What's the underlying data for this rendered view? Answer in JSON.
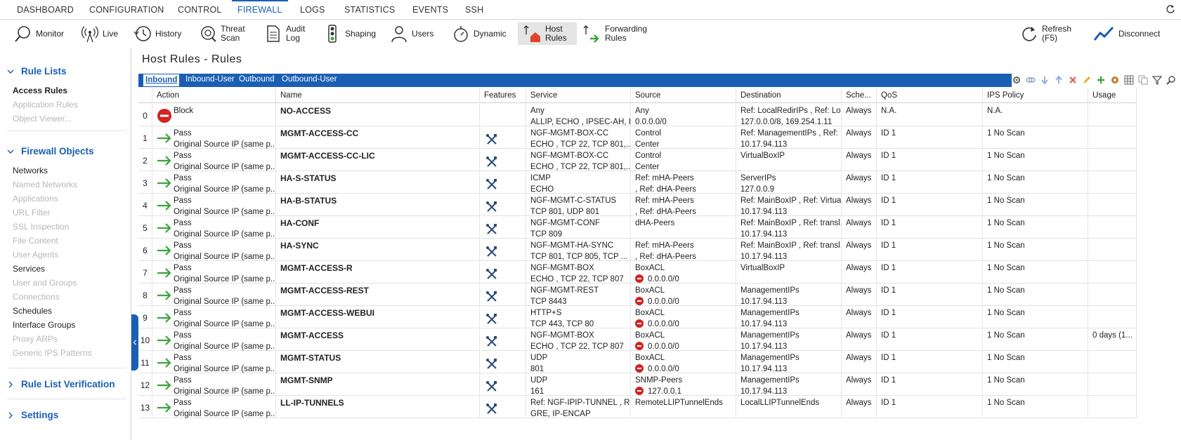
{
  "top_menu": [
    "DASHBOARD",
    "CONFIGURATION",
    "CONTROL",
    "FIREWALL",
    "LOGS",
    "STATISTICS",
    "EVENTS",
    "SSH"
  ],
  "active_menu": "FIREWALL",
  "toolbar": {
    "monitor": "Monitor",
    "live": "Live",
    "history": "History",
    "threat_scan_1": "Threat",
    "threat_scan_2": "Scan",
    "audit_log_1": "Audit",
    "audit_log_2": "Log",
    "shaping": "Shaping",
    "users": "Users",
    "dynamic": "Dynamic",
    "host_rules_1": "Host",
    "host_rules_2": "Rules",
    "forwarding_rules_1": "Forwarding",
    "forwarding_rules_2": "Rules",
    "refresh_1": "Refresh",
    "refresh_2": "(F5)",
    "disconnect": "Disconnect"
  },
  "sidebar": {
    "rule_lists": "Rule Lists",
    "access_rules": "Access Rules",
    "application_rules": "Application Rules",
    "object_viewer": "Object Viewer...",
    "firewall_objects": "Firewall Objects",
    "objects": [
      "Networks",
      "Named Networks",
      "Applications",
      "URL Filter",
      "SSL Inspection",
      "File Content",
      "User Agents",
      "Services",
      "User and Groups",
      "Connections",
      "Schedules",
      "Interface Groups",
      "Proxy ARPs",
      "Generic IPS Patterns"
    ],
    "rule_list_verification": "Rule List Verification",
    "settings": "Settings"
  },
  "page_title": "Host Rules - Rules",
  "tabs": [
    "Inbound",
    "Inbound-User",
    "Outbound",
    "Outbound-User"
  ],
  "columns": [
    "Action",
    "Name",
    "Features",
    "Service",
    "Source",
    "Destination",
    "Sche...",
    "QoS",
    "IPS Policy",
    "Usage"
  ],
  "rows": [
    {
      "num": "0",
      "action": "Block",
      "action2": "",
      "name": "NO-ACCESS",
      "service1": "Any",
      "service2": "ALLIP, ECHO , IPSEC-AH, I...",
      "source1": "Any",
      "source2": "0.0.0.0/0",
      "dest1": "Ref: LocalRedirIPs , Ref: Lo...",
      "dest2": "127.0.0.0/8, 169.254.1.11",
      "sched": "Always",
      "qos": "N.A.",
      "ips": "N.A.",
      "usage": ""
    },
    {
      "num": "1",
      "action": "Pass",
      "action2": "Original Source IP (same p...",
      "name": "MGMT-ACCESS-CC",
      "service1": "NGF-MGMT-BOX-CC",
      "service2": "ECHO , TCP  22, TCP  801,...",
      "source1": "Control",
      "source2": "Center",
      "dest1": "Ref: ManagementIPs , Ref: ...",
      "dest2": "10.17.94.113",
      "sched": "Always",
      "qos": "ID 1",
      "ips": "1 No Scan",
      "usage": ""
    },
    {
      "num": "2",
      "action": "Pass",
      "action2": "Original Source IP (same p...",
      "name": "MGMT-ACCESS-CC-LIC",
      "service1": "NGF-MGMT-BOX-CC",
      "service2": "ECHO , TCP  22, TCP  801,...",
      "source1": "Control",
      "source2": "Center",
      "dest1": "VirtualBoxIP",
      "dest2": "",
      "sched": "Always",
      "qos": "ID 1",
      "ips": "1 No Scan",
      "usage": ""
    },
    {
      "num": "3",
      "action": "Pass",
      "action2": "Original Source IP (same p...",
      "name": "HA-S-STATUS",
      "service1": "ICMP",
      "service2": "ECHO",
      "source1": "Ref: mHA-Peers",
      "source2": ", Ref: dHA-Peers",
      "dest1": "ServerIPs",
      "dest2": "127.0.0.9",
      "sched": "Always",
      "qos": "ID 1",
      "ips": "1 No Scan",
      "usage": ""
    },
    {
      "num": "4",
      "action": "Pass",
      "action2": "Original Source IP (same p...",
      "name": "HA-B-STATUS",
      "service1": "NGF-MGMT-C-STATUS",
      "service2": "TCP  801, UDP  801",
      "source1": "Ref: mHA-Peers",
      "source2": ", Ref: dHA-Peers",
      "dest1": "Ref: MainBoxIP , Ref: Virtua...",
      "dest2": "10.17.94.113",
      "sched": "Always",
      "qos": "ID 1",
      "ips": "1 No Scan",
      "usage": ""
    },
    {
      "num": "5",
      "action": "Pass",
      "action2": "Original Source IP (same p...",
      "name": "HA-CONF",
      "service1": "NGF-MGMT-CONF",
      "service2": "TCP  809",
      "source1": "dHA-Peers",
      "source2": "",
      "dest1": "Ref: MainBoxIP , Ref: transl...",
      "dest2": "10.17.94.113",
      "sched": "Always",
      "qos": "ID 1",
      "ips": "1 No Scan",
      "usage": ""
    },
    {
      "num": "6",
      "action": "Pass",
      "action2": "Original Source IP (same p...",
      "name": "HA-SYNC",
      "service1": "NGF-MGMT-HA-SYNC",
      "service2": "TCP  801, TCP  805, TCP  ...",
      "source1": "Ref: mHA-Peers",
      "source2": ", Ref: dHA-Peers",
      "dest1": "Ref: MainBoxIP , Ref: transl...",
      "dest2": "10.17.94.113",
      "sched": "Always",
      "qos": "ID 1",
      "ips": "1 No Scan",
      "usage": ""
    },
    {
      "num": "7",
      "action": "Pass",
      "action2": "Original Source IP (same p...",
      "name": "MGMT-ACCESS-R",
      "service1": "NGF-MGMT-BOX",
      "service2": "ECHO , TCP  22, TCP  807",
      "source1": "BoxACL",
      "source2": "0.0.0.0/0",
      "src_neg": true,
      "dest1": "VirtualBoxIP",
      "dest2": "",
      "sched": "Always",
      "qos": "ID 1",
      "ips": "1 No Scan",
      "usage": ""
    },
    {
      "num": "8",
      "action": "Pass",
      "action2": "Original Source IP (same p...",
      "name": "MGMT-ACCESS-REST",
      "service1": "NGF-MGMT-REST",
      "service2": "TCP  8443",
      "source1": "BoxACL",
      "source2": "0.0.0.0/0",
      "src_neg": true,
      "dest1": "ManagementIPs",
      "dest2": "10.17.94.113",
      "sched": "Always",
      "qos": "ID 1",
      "ips": "1 No Scan",
      "usage": ""
    },
    {
      "num": "9",
      "action": "Pass",
      "action2": "Original Source IP (same p...",
      "name": "MGMT-ACCESS-WEBUI",
      "service1": "HTTP+S",
      "service2": "TCP  443, TCP  80",
      "source1": "BoxACL",
      "source2": "0.0.0.0/0",
      "src_neg": true,
      "dest1": "ManagementIPs",
      "dest2": "10.17.94.113",
      "sched": "Always",
      "qos": "ID 1",
      "ips": "1 No Scan",
      "usage": ""
    },
    {
      "num": "10",
      "action": "Pass",
      "action2": "Original Source IP (same p...",
      "name": "MGMT-ACCESS",
      "service1": "NGF-MGMT-BOX",
      "service2": "ECHO , TCP  22, TCP  807",
      "source1": "BoxACL",
      "source2": "0.0.0.0/0",
      "src_neg": true,
      "dest1": "ManagementIPs",
      "dest2": "10.17.94.113",
      "sched": "Always",
      "qos": "ID 1",
      "ips": "1 No Scan",
      "usage": "0 days (1..."
    },
    {
      "num": "11",
      "action": "Pass",
      "action2": "Original Source IP (same p...",
      "name": "MGMT-STATUS",
      "service1": "UDP",
      "service2": "801",
      "source1": "BoxACL",
      "source2": "0.0.0.0/0",
      "src_neg": true,
      "dest1": "ManagementIPs",
      "dest2": "10.17.94.113",
      "sched": "Always",
      "qos": "ID 1",
      "ips": "1 No Scan",
      "usage": ""
    },
    {
      "num": "12",
      "action": "Pass",
      "action2": "Original Source IP (same p...",
      "name": "MGMT-SNMP",
      "service1": "UDP",
      "service2": "161",
      "source1": "SNMP-Peers",
      "source2": "127.0.0.1",
      "src_neg": true,
      "dest1": "ManagementIPs",
      "dest2": "10.17.94.113",
      "sched": "Always",
      "qos": "ID 1",
      "ips": "1 No Scan",
      "usage": ""
    },
    {
      "num": "13",
      "action": "Pass",
      "action2": "Original Source IP (same p...",
      "name": "LL-IP-TUNNELS",
      "service1": "Ref: NGF-IPIP-TUNNEL , R...",
      "service2": "GRE, IP-ENCAP",
      "source1": "RemoteLLIPTunnelEnds",
      "source2": "",
      "dest1": "LocalLLIPTunnelEnds",
      "dest2": "",
      "sched": "Always",
      "qos": "ID 1",
      "ips": "1 No Scan",
      "usage": ""
    }
  ],
  "colors": {
    "accent": "#1a5fb4",
    "pass_arrow": "#3aa53a",
    "block": "#d32222"
  }
}
